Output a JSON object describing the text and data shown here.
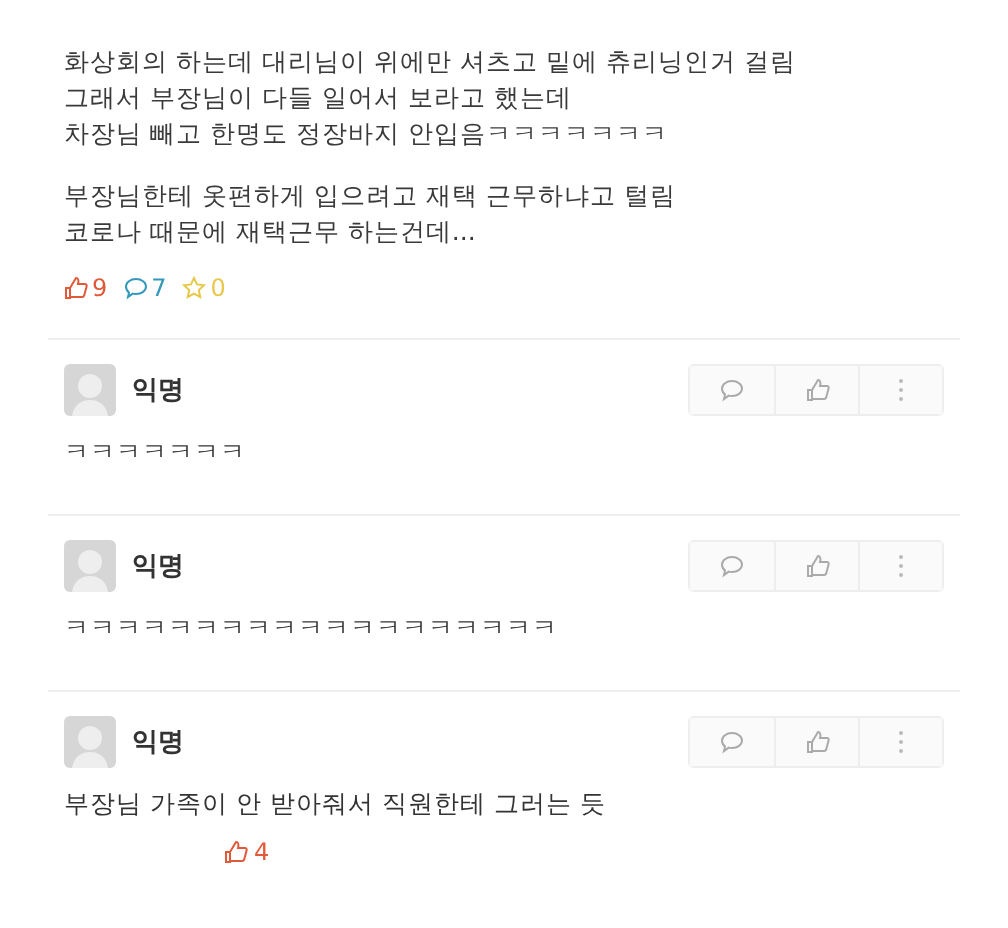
{
  "post": {
    "paragraphs": [
      [
        "화상회의 하는데 대리님이 위에만 셔츠고 밑에 츄리닝인거 걸림",
        "그래서 부장님이 다들 일어서 보라고 했는데",
        "차장님 빼고 한명도 정장바지 안입음ㅋㅋㅋㅋㅋㅋㅋ"
      ],
      [
        "부장님한테 옷편하게 입으려고 재택 근무하냐고 털림",
        "코로나 때문에 재택근무 하는건데..."
      ]
    ],
    "likes": "9",
    "comments": "7",
    "scraps": "0"
  },
  "comments": [
    {
      "author": "익명",
      "text": "ㅋㅋㅋㅋㅋㅋㅋ"
    },
    {
      "author": "익명",
      "text": "ㅋㅋㅋㅋㅋㅋㅋㅋㅋㅋㅋㅋㅋㅋㅋㅋㅋㅋㅋ"
    },
    {
      "author": "익명",
      "text": "부장님 가족이 안 받아줘서 직원한테 그러는 듯",
      "likes": "4"
    }
  ]
}
